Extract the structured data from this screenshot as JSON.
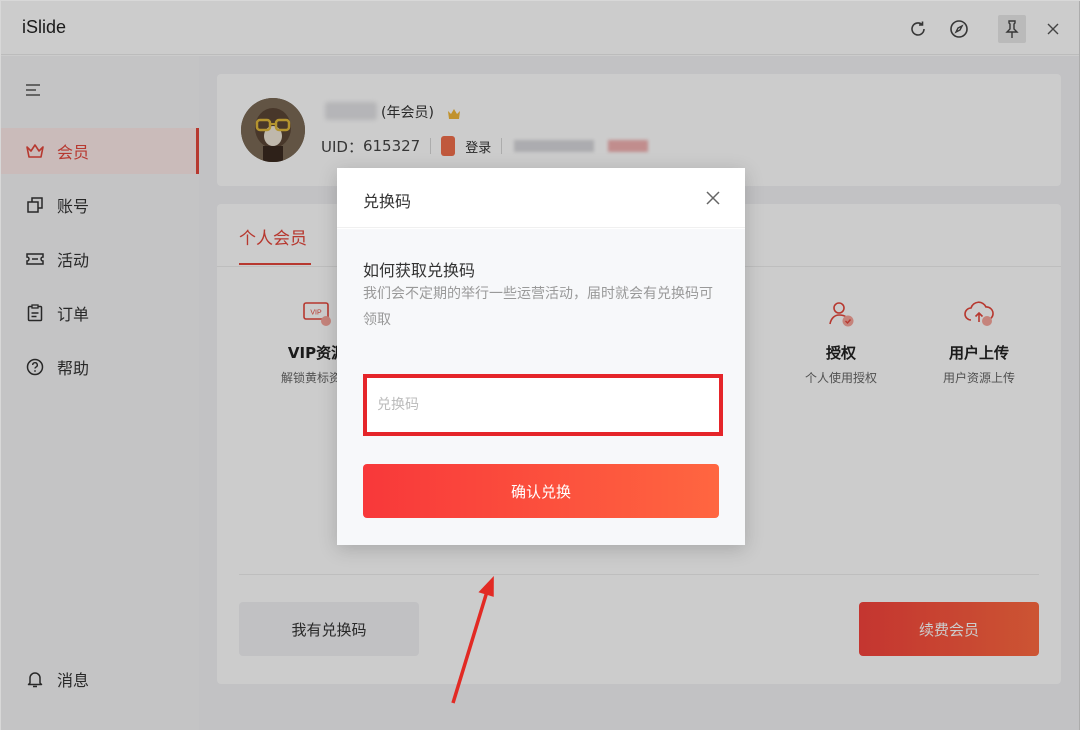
{
  "app": {
    "title": "iSlide"
  },
  "titlebar": {
    "icons": [
      "refresh-icon",
      "compass-icon",
      "pin-icon",
      "close-icon"
    ]
  },
  "sidebar": {
    "items": [
      {
        "label": "会员",
        "icon": "crown-icon",
        "active": true
      },
      {
        "label": "账号",
        "icon": "account-icon",
        "active": false
      },
      {
        "label": "活动",
        "icon": "ticket-icon",
        "active": false
      },
      {
        "label": "订单",
        "icon": "order-icon",
        "active": false
      },
      {
        "label": "帮助",
        "icon": "help-icon",
        "active": false
      }
    ],
    "bottom_item": {
      "label": "消息",
      "icon": "bell-icon"
    }
  },
  "profile": {
    "member_type": "(年会员)",
    "uid_label": "UID：",
    "uid_value": "615327",
    "login_label": "登录"
  },
  "member_card": {
    "tab_label": "个人会员",
    "features": [
      {
        "title": "VIP资源",
        "subtitle": "解锁黄标资源",
        "icon": "vip-icon"
      },
      {
        "title": "授权",
        "subtitle": "个人使用授权",
        "icon": "license-icon"
      },
      {
        "title": "用户上传",
        "subtitle": "用户资源上传",
        "icon": "cloud-upload-icon"
      }
    ],
    "have_code_label": "我有兑换码",
    "renew_label": "续费会员"
  },
  "modal": {
    "title": "兑换码",
    "how_title": "如何获取兑换码",
    "how_desc": "我们会不定期的举行一些运营活动，届时就会有兑换码可领取",
    "input_placeholder": "兑换码",
    "input_value": "",
    "confirm_label": "确认兑换"
  },
  "colors": {
    "accent": "#e5463b",
    "highlight_border": "#e5252a",
    "button_gradient_start": "#f8383a",
    "button_gradient_end": "#ff6640"
  }
}
